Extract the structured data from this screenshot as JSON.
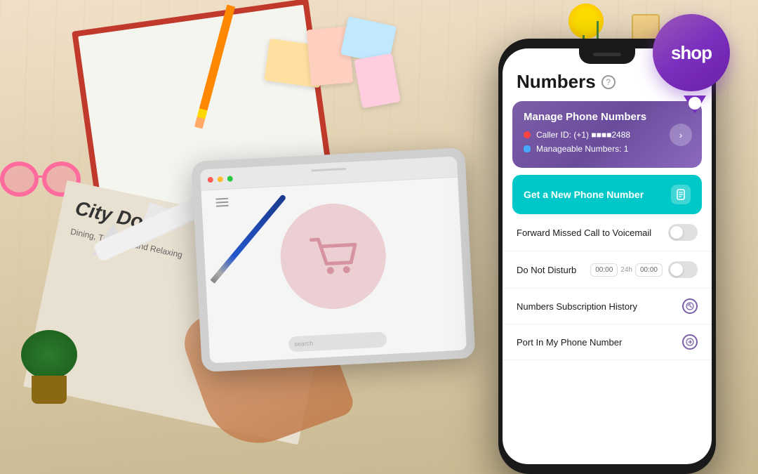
{
  "background": {
    "color": "#e8d5b5"
  },
  "shop_logo": {
    "text": "shop",
    "color": "#7b2fbe"
  },
  "tablet": {
    "search_placeholder": "search"
  },
  "phone": {
    "title": "Numbers",
    "help_label": "?",
    "manage_card": {
      "title": "Manage Phone Numbers",
      "caller_id_label": "Caller ID: (+1) ■■■■2488",
      "manageable_label": "Manageable Numbers: 1",
      "arrow": "→"
    },
    "new_number_btn": {
      "label": "Get a New Phone Number",
      "icon": "📄"
    },
    "menu_items": [
      {
        "label": "Forward Missed Call to Voicemail",
        "right_type": "toggle"
      },
      {
        "label": "Do Not Disturb",
        "right_type": "time_toggle",
        "time_start": "00:00",
        "time_format": "24h",
        "time_end": "00:00"
      },
      {
        "label": "Numbers Subscription History",
        "right_type": "history"
      },
      {
        "label": "Port In My Phone Number",
        "right_type": "port"
      }
    ]
  },
  "newspaper": {
    "title": "City Do",
    "subtitle": "Dining, Traveling and Relaxing"
  }
}
